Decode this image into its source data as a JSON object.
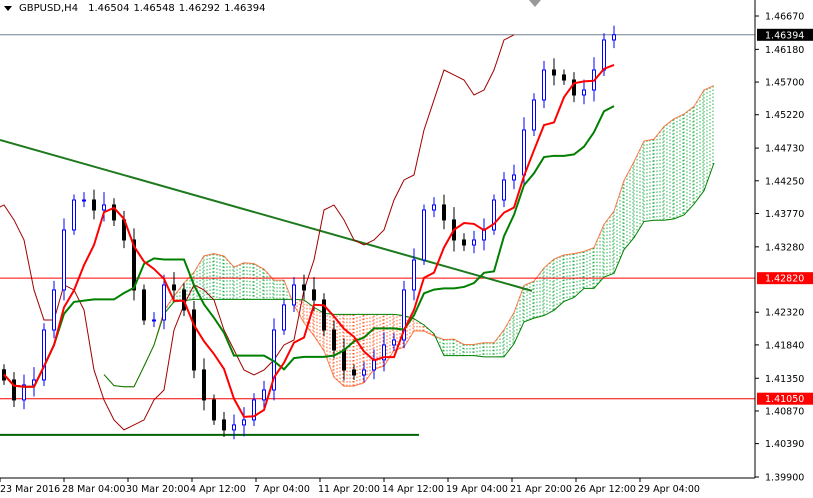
{
  "header": {
    "symbol": "GBPUSD,H4",
    "open": "1.46504",
    "high": "1.46548",
    "low": "1.46292",
    "close": "1.46394"
  },
  "colors": {
    "bull": "#0000ff",
    "bear": "#000000",
    "tenkan": "#ff0000",
    "kijun": "#008000",
    "chikou": "#a00000",
    "cloud_up": "#22b04a",
    "cloud_down": "#ff5a1f",
    "hline": "#ff0000",
    "trend": "#1e7a1e",
    "support": "#006400",
    "price_line": "#708090"
  },
  "chart_data": {
    "type": "candlestick",
    "title": "GBPUSD,H4",
    "ylim": [
      1.399,
      1.4667
    ],
    "closes": [
      1.41325,
      1.41032,
      1.41252,
      1.41325,
      1.42059,
      1.42647,
      1.43528,
      1.43968,
      1.43968,
      1.43821,
      1.43895,
      1.43675,
      1.43381,
      1.42647,
      1.42206,
      1.42206,
      1.4272,
      1.42647,
      1.42353,
      1.41472,
      1.41032,
      1.40738,
      1.40592,
      1.40665,
      1.40738,
      1.41032,
      1.41178,
      1.42059,
      1.42427,
      1.4272,
      1.42647,
      1.425,
      1.42059,
      1.41765,
      1.41472,
      1.41398,
      1.41472,
      1.4162,
      1.41839,
      1.41912,
      1.42647,
      1.43087,
      1.43821,
      1.43895,
      1.43675,
      1.43381,
      1.43307,
      1.43381,
      1.43528,
      1.43968,
      1.44262,
      1.44335,
      1.44996,
      1.45437,
      1.45877,
      1.45804,
      1.4573,
      1.4551,
      1.45583,
      1.45877,
      1.46318,
      1.46394
    ],
    "ichimoku": {
      "tenkan": 4,
      "kijun": 10,
      "senkou_b": 21,
      "shift": 10
    },
    "price_ticks": [
      "1.46670",
      "1.46180",
      "1.45700",
      "1.45220",
      "1.44730",
      "1.44250",
      "1.43770",
      "1.43280",
      "1.42320",
      "1.41840",
      "1.41350",
      "1.40870",
      "1.40390",
      "1.39900"
    ],
    "time_ticks": [
      "23 Mar 2016",
      "28 Mar 04:00",
      "30 Mar 20:00",
      "4 Apr 12:00",
      "7 Apr 04:00",
      "11 Apr 20:00",
      "14 Apr 12:00",
      "19 Apr 04:00",
      "21 Apr 20:00",
      "26 Apr 12:00",
      "29 Apr 04:00"
    ],
    "horizontal_levels": [
      {
        "price": 1.4282,
        "label": "1.42820"
      },
      {
        "price": 1.4105,
        "label": "1.41050"
      }
    ],
    "current_price": {
      "price": 1.46394,
      "label": "1.46394"
    },
    "support_line": {
      "price": 1.40519,
      "from_index": 0,
      "to_index": 41.5
    },
    "trend_line": {
      "from": [
        0,
        1.4485
      ],
      "to": [
        52.8,
        1.42633
      ]
    }
  }
}
